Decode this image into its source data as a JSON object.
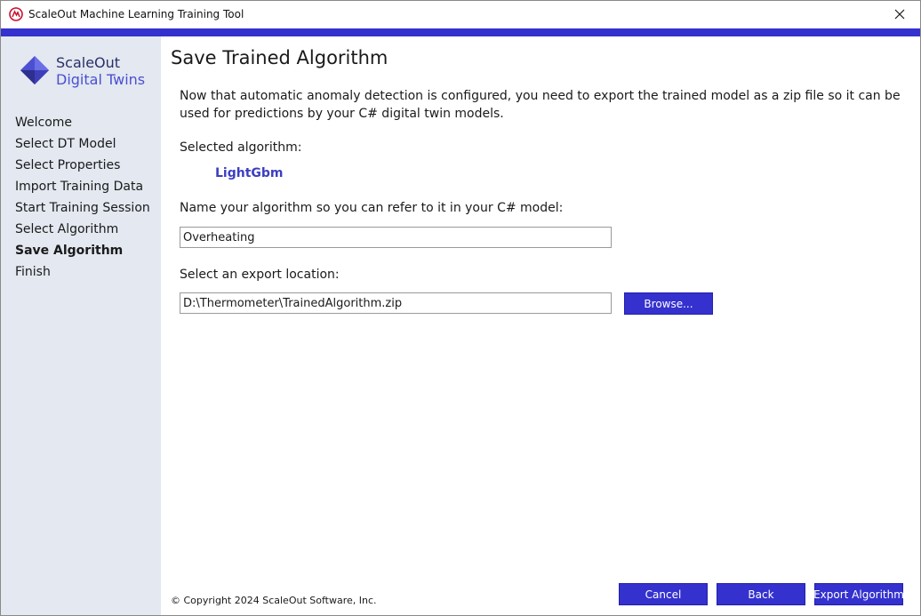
{
  "window": {
    "title": "ScaleOut Machine Learning Training Tool",
    "app_icon": "app-logo-icon",
    "close_icon": "close-icon",
    "accent_color": "#3431cf"
  },
  "sidebar": {
    "logo": {
      "line1": "ScaleOut",
      "line2": "Digital Twins"
    },
    "items": [
      {
        "label": "Welcome",
        "active": false
      },
      {
        "label": "Select DT Model",
        "active": false
      },
      {
        "label": "Select Properties",
        "active": false
      },
      {
        "label": "Import Training Data",
        "active": false
      },
      {
        "label": "Start Training Session",
        "active": false
      },
      {
        "label": "Select Algorithm",
        "active": false
      },
      {
        "label": "Save Algorithm",
        "active": true
      },
      {
        "label": "Finish",
        "active": false
      }
    ]
  },
  "main": {
    "title": "Save Trained Algorithm",
    "intro": "Now that automatic anomaly detection is configured, you need to export the trained model as a zip file so it can be used for predictions by your C# digital twin models.",
    "selected_label": "Selected algorithm:",
    "selected_algorithm": "LightGbm",
    "name_label": "Name your algorithm so you can refer to it in your C# model:",
    "name_value": "Overheating",
    "export_label": "Select an export location:",
    "export_value": "D:\\Thermometer\\TrainedAlgorithm.zip",
    "browse_label": "Browse..."
  },
  "footer": {
    "copyright": "© Copyright 2024 ScaleOut Software, Inc.",
    "cancel_label": "Cancel",
    "back_label": "Back",
    "export_label": "Export Algorithm"
  }
}
